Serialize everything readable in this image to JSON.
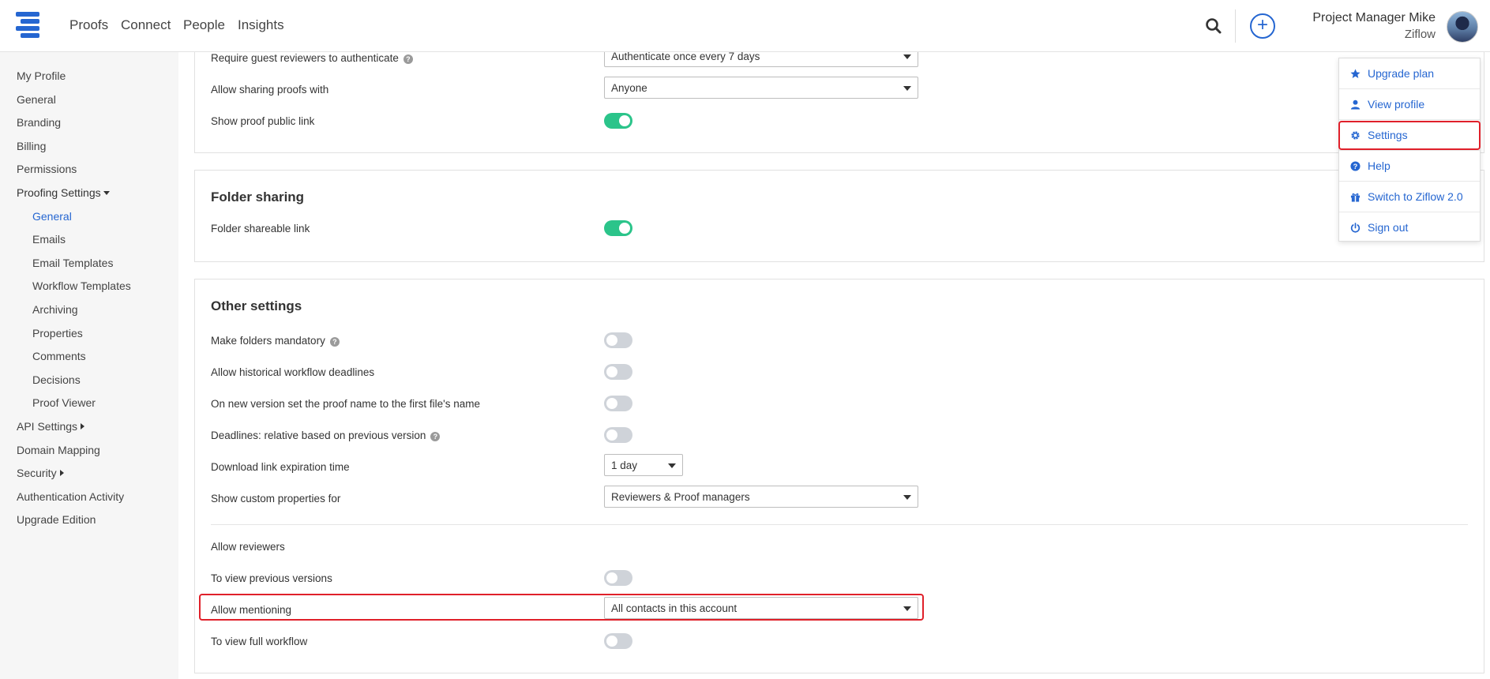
{
  "nav": {
    "items": [
      "Proofs",
      "Connect",
      "People",
      "Insights"
    ],
    "user_name": "Project Manager Mike",
    "org": "Ziflow"
  },
  "sidebar": {
    "my_profile": "My Profile",
    "general": "General",
    "branding": "Branding",
    "billing": "Billing",
    "permissions": "Permissions",
    "proofing_settings": "Proofing Settings",
    "proofing_sub": [
      "General",
      "Emails",
      "Email Templates",
      "Workflow Templates",
      "Archiving",
      "Properties",
      "Comments",
      "Decisions",
      "Proof Viewer"
    ],
    "api_settings": "API Settings",
    "domain_mapping": "Domain Mapping",
    "security": "Security",
    "auth_activity": "Authentication Activity",
    "upgrade_edition": "Upgrade Edition"
  },
  "sharing": {
    "require_guest_label": "Require guest reviewers to authenticate",
    "require_guest_value": "Authenticate once every 7 days",
    "allow_sharing_label": "Allow sharing proofs with",
    "allow_sharing_value": "Anyone",
    "public_link_label": "Show proof public link"
  },
  "folder_sharing": {
    "title": "Folder sharing",
    "shareable_label": "Folder shareable link"
  },
  "other": {
    "title": "Other settings",
    "folders_mandatory": "Make folders mandatory",
    "historical_deadlines": "Allow historical workflow deadlines",
    "new_version_name": "On new version set the proof name to the first file's name",
    "deadlines_relative": "Deadlines: relative based on previous version",
    "download_expiration_label": "Download link expiration time",
    "download_expiration_value": "1 day",
    "custom_props_label": "Show custom properties for",
    "custom_props_value": "Reviewers & Proof managers",
    "allow_reviewers": "Allow reviewers",
    "view_previous": "To view previous versions",
    "allow_mentioning_label": "Allow mentioning",
    "allow_mentioning_value": "All contacts in this account",
    "view_workflow": "To view full workflow"
  },
  "menu": {
    "upgrade": "Upgrade plan",
    "view_profile": "View profile",
    "settings": "Settings",
    "help": "Help",
    "switch": "Switch to Ziflow 2.0",
    "sign_out": "Sign out"
  },
  "toggles": {
    "public_link": true,
    "folder_shareable": true,
    "folders_mandatory": false,
    "historical_deadlines": false,
    "new_version_name": false,
    "deadlines_relative": false,
    "view_previous": false,
    "view_workflow": false
  },
  "colors": {
    "accent": "#2566d1",
    "toggle_on": "#2bc48a",
    "highlight": "#e0202a"
  }
}
